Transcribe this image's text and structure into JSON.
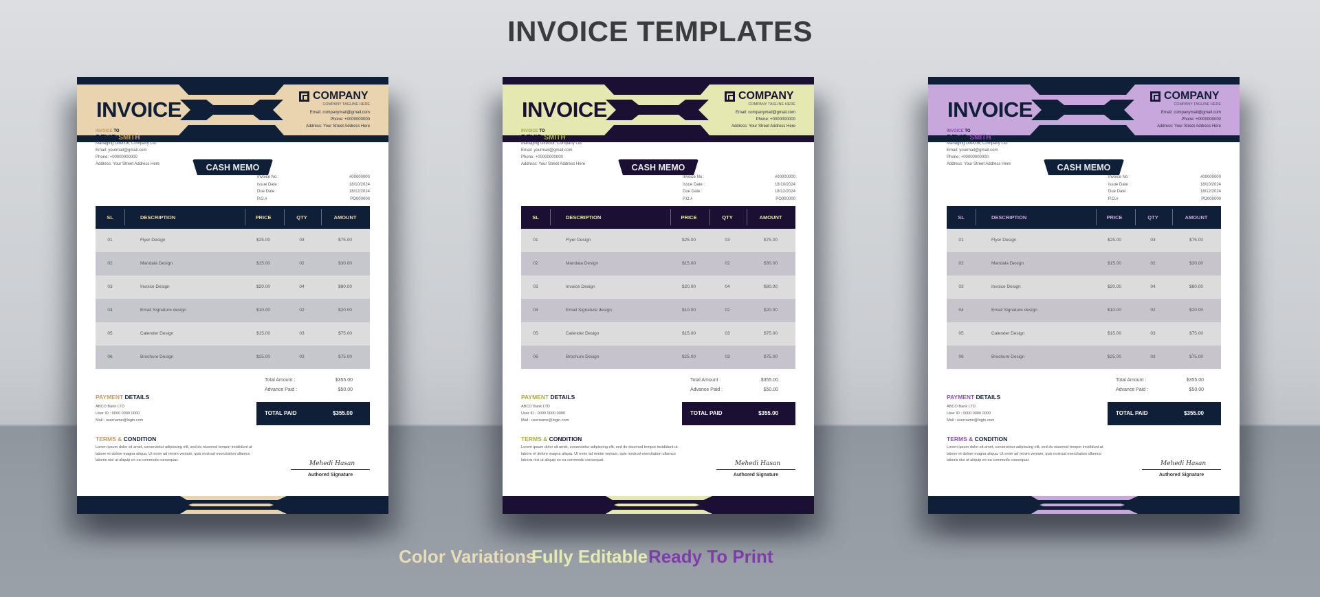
{
  "title": "INVOICE TEMPLATES",
  "features": [
    {
      "label": "Color Variations",
      "color": "#e8dcb8"
    },
    {
      "label": "Fully Editable",
      "color": "#e4eab0"
    },
    {
      "label": "Ready To Print",
      "color": "#7e3da8"
    }
  ],
  "invoice": {
    "heading": "INVOICE",
    "company": {
      "icon": "square-logo-icon",
      "name": "COMPANY",
      "tagline": "COMPANY TAGLINE HERE",
      "email": "Email: companymail@gmail.com",
      "phone": "Phone: +0000000000",
      "address": "Address: Your Street Address Here"
    },
    "badge": "CASH MEMO",
    "bill_to": {
      "label_a": "INVOICE",
      "label_b": " TO",
      "first": "DEVID",
      "last": " SMITH",
      "role": "Managing Director, Company Ltd.",
      "email": "Email: yourmail@gmail.com",
      "phone": "Phone: +00000000000",
      "address": "Address:  Your Street Address Here"
    },
    "meta": [
      {
        "label": "Invoice No :",
        "value": "#00000000"
      },
      {
        "label": "Issue Date :",
        "value": "18/10/2024"
      },
      {
        "label": "Due Date :",
        "value": "18/12/2024"
      },
      {
        "label": "P.O.#",
        "value": "PO000000"
      }
    ],
    "columns": [
      "SL",
      "DESCRIPTION",
      "PRICE",
      "QTY",
      "AMOUNT"
    ],
    "rows": [
      [
        "01",
        "Flyer Design",
        "$25.00",
        "03",
        "$75.00"
      ],
      [
        "02",
        "Mandala Design",
        "$15.00",
        "02",
        "$30.00"
      ],
      [
        "03",
        "Invoice Design",
        "$20.00",
        "04",
        "$80.00"
      ],
      [
        "04",
        "Email Signature design",
        "$10.00",
        "02",
        "$20.00"
      ],
      [
        "05",
        "Calender Design",
        "$15.00",
        "03",
        "$75.00"
      ],
      [
        "06",
        "Brochure Design",
        "$25.00",
        "03",
        "$75.00"
      ]
    ],
    "totals": [
      {
        "label": "Total Amount :",
        "value": "$355.00"
      },
      {
        "label": "Advance Paid :",
        "value": "$50.00"
      }
    ],
    "total_paid": {
      "label": "TOTAL PAID",
      "value": "$355.00"
    },
    "payment": {
      "title_a": "PAYMENT",
      "title_b": " DETAILS",
      "lines": [
        "ABCO Bank LTD",
        "User ID : 0000 0000 0000",
        "Mail : username@login.com"
      ]
    },
    "terms": {
      "title_a": "TERMS &",
      "title_b": " CONDITION",
      "text": "Lorem ipsum dolor sit amet, consectetur adipiscing elit, sed do eiusmod tempor incididunt ut labore et dolore magna aliqua. Ut enim ad minim veniam, quis nostrud exercitation ullamco laboris nisi ut aliquip ex ea commodo consequat."
    },
    "signature": {
      "script": "Mehedi Hasan",
      "label": "Authored Signature"
    }
  },
  "variants": [
    {
      "accent": "#e9d4af",
      "accent_text": "#c49a5e",
      "dark": "#0f1f38",
      "row_a": "#dcdcdd",
      "row_b": "#c5c7cd",
      "th_color": "#e9d4af"
    },
    {
      "accent": "#e5e8b0",
      "accent_text": "#a9ab3c",
      "dark": "#1b1034",
      "row_a": "#dcdcdd",
      "row_b": "#c6c3cd",
      "th_color": "#e5e8b0"
    },
    {
      "accent": "#c8a7dc",
      "accent_text": "#8a4fb0",
      "dark": "#0f1f38",
      "row_a": "#dcdcdd",
      "row_b": "#c8c4cc",
      "th_color": "#c8a7dc"
    }
  ]
}
